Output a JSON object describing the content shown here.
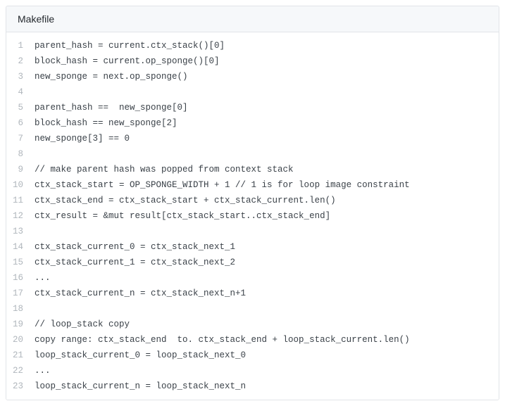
{
  "header": {
    "language": "Makefile"
  },
  "code": {
    "lines": [
      {
        "n": "1",
        "t": "parent_hash = current.ctx_stack()[0]"
      },
      {
        "n": "2",
        "t": "block_hash = current.op_sponge()[0]"
      },
      {
        "n": "3",
        "t": "new_sponge = next.op_sponge()"
      },
      {
        "n": "4",
        "t": ""
      },
      {
        "n": "5",
        "t": "parent_hash ==  new_sponge[0]"
      },
      {
        "n": "6",
        "t": "block_hash == new_sponge[2]"
      },
      {
        "n": "7",
        "t": "new_sponge[3] == 0"
      },
      {
        "n": "8",
        "t": ""
      },
      {
        "n": "9",
        "t": "// make parent hash was popped from context stack"
      },
      {
        "n": "10",
        "t": "ctx_stack_start = OP_SPONGE_WIDTH + 1 // 1 is for loop image constraint"
      },
      {
        "n": "11",
        "t": "ctx_stack_end = ctx_stack_start + ctx_stack_current.len()"
      },
      {
        "n": "12",
        "t": "ctx_result = &mut result[ctx_stack_start..ctx_stack_end]"
      },
      {
        "n": "13",
        "t": ""
      },
      {
        "n": "14",
        "t": "ctx_stack_current_0 = ctx_stack_next_1"
      },
      {
        "n": "15",
        "t": "ctx_stack_current_1 = ctx_stack_next_2"
      },
      {
        "n": "16",
        "t": "..."
      },
      {
        "n": "17",
        "t": "ctx_stack_current_n = ctx_stack_next_n+1"
      },
      {
        "n": "18",
        "t": ""
      },
      {
        "n": "19",
        "t": "// loop_stack copy"
      },
      {
        "n": "20",
        "t": "copy range: ctx_stack_end  to. ctx_stack_end + loop_stack_current.len()"
      },
      {
        "n": "21",
        "t": "loop_stack_current_0 = loop_stack_next_0"
      },
      {
        "n": "22",
        "t": "..."
      },
      {
        "n": "23",
        "t": "loop_stack_current_n = loop_stack_next_n"
      }
    ]
  }
}
